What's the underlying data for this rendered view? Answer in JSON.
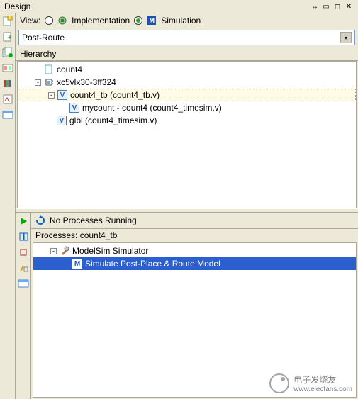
{
  "panel": {
    "title": "Design"
  },
  "view": {
    "label": "View:",
    "implementation": "Implementation",
    "simulation": "Simulation",
    "selected": "simulation"
  },
  "dropdown": {
    "selected": "Post-Route"
  },
  "hierarchy": {
    "label": "Hierarchy",
    "items": [
      {
        "indent": 1,
        "exp": "",
        "icon": "page",
        "label": "count4"
      },
      {
        "indent": 1,
        "exp": "-",
        "icon": "chip",
        "label": "xc5vlx30-3ff324"
      },
      {
        "indent": 2,
        "exp": "-",
        "icon": "v",
        "label": "count4_tb (count4_tb.v)",
        "selected": true
      },
      {
        "indent": 3,
        "exp": "",
        "icon": "v",
        "label": "mycount - count4 (count4_timesim.v)"
      },
      {
        "indent": 2,
        "exp": "",
        "icon": "v",
        "label": "glbl (count4_timesim.v)"
      }
    ]
  },
  "processes": {
    "status": "No Processes Running",
    "header_prefix": "Processes: ",
    "header_target": "count4_tb",
    "items": [
      {
        "indent": 1,
        "exp": "-",
        "icon": "tool",
        "label": "ModelSim Simulator"
      },
      {
        "indent": 2,
        "exp": "",
        "icon": "m",
        "label": "Simulate Post-Place & Route Model",
        "selected": true
      }
    ]
  },
  "watermark": {
    "text_cn": "电子发烧友",
    "url": "www.elecfans.com"
  }
}
